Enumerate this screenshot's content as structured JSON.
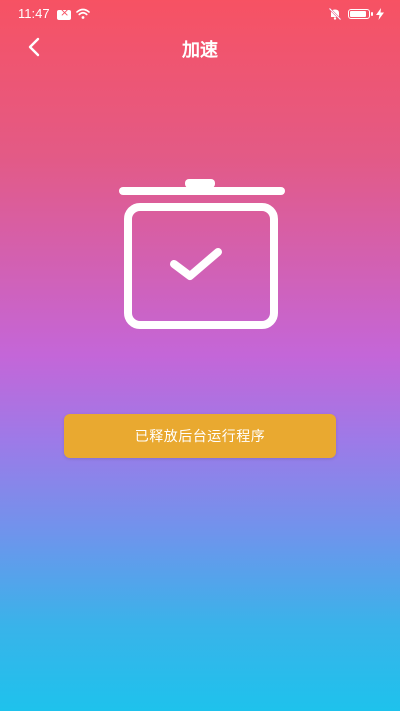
{
  "status_bar": {
    "time": "11:47",
    "icons": [
      "notification-icon",
      "wifi-icon",
      "mute-icon",
      "battery-icon",
      "charging-icon"
    ]
  },
  "header": {
    "title": "加速",
    "back_icon": "chevron-left-icon"
  },
  "hero": {
    "icon": "cleaned-bin-check-icon"
  },
  "action": {
    "label": "已释放后台运行程序"
  },
  "colors": {
    "gradient_top": "#f75263",
    "gradient_mid": "#c466d8",
    "gradient_bottom": "#1ec2ec",
    "button": "#e9a930",
    "foreground": "#ffffff"
  }
}
